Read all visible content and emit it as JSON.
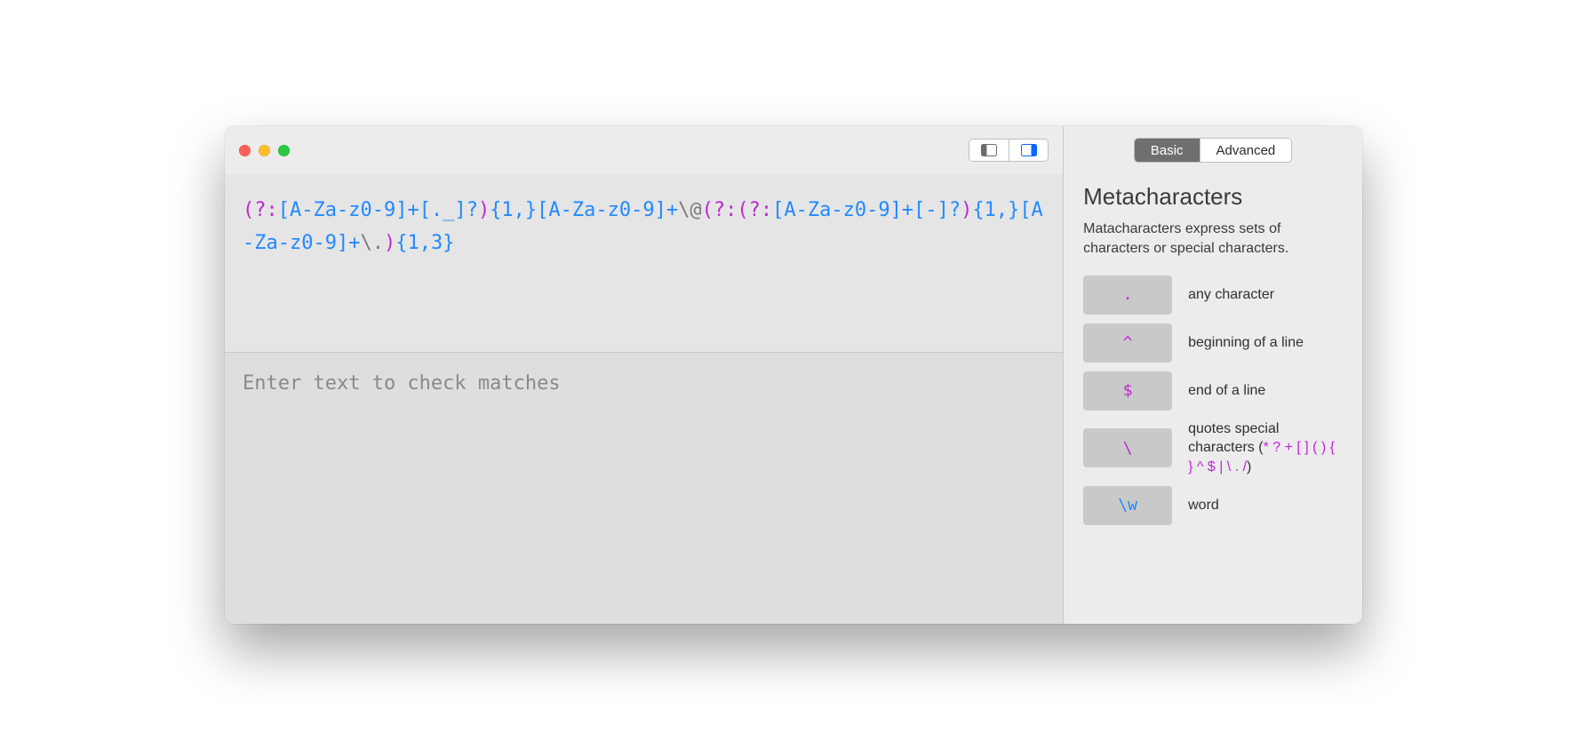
{
  "regex_tokens": [
    {
      "t": "(?:",
      "c": "magenta"
    },
    {
      "t": "[A-Za-z0-9]",
      "c": "blue"
    },
    {
      "t": "+",
      "c": "blue"
    },
    {
      "t": "[._]",
      "c": "blue"
    },
    {
      "t": "?",
      "c": "blue"
    },
    {
      "t": ")",
      "c": "magenta"
    },
    {
      "t": "{1,}",
      "c": "blue"
    },
    {
      "t": "[A-Za-z0-9]",
      "c": "blue"
    },
    {
      "t": "+",
      "c": "blue"
    },
    {
      "t": "\\",
      "c": "gray"
    },
    {
      "t": "@",
      "c": "gray"
    },
    {
      "t": "(?:",
      "c": "magenta"
    },
    {
      "t": "(?:",
      "c": "magenta"
    },
    {
      "t": "[A-Za-z0-9]",
      "c": "blue"
    },
    {
      "t": "+",
      "c": "blue"
    },
    {
      "t": "[-]",
      "c": "blue"
    },
    {
      "t": "?",
      "c": "blue"
    },
    {
      "t": ")",
      "c": "magenta"
    },
    {
      "t": "{1,}",
      "c": "blue"
    },
    {
      "t": "[A-Za-z0-9]",
      "c": "blue"
    },
    {
      "t": "+",
      "c": "blue"
    },
    {
      "t": "\\.",
      "c": "gray"
    },
    {
      "t": ")",
      "c": "magenta"
    },
    {
      "t": "{1,3}",
      "c": "blue"
    }
  ],
  "match_placeholder": "Enter text to check matches",
  "tabs": {
    "basic": "Basic",
    "advanced": "Advanced"
  },
  "sidebar": {
    "title": "Metacharacters",
    "desc": "Matacharacters express sets of characters or special characters.",
    "items": [
      {
        "symbol": ".",
        "color": "magenta",
        "label": "any character"
      },
      {
        "symbol": "^",
        "color": "magenta",
        "label": "beginning of a line"
      },
      {
        "symbol": "$",
        "color": "magenta",
        "label": "end of a line"
      },
      {
        "symbol": "\\",
        "color": "magenta",
        "label_prefix": "quotes special characters (",
        "label_highlight": "* ? + [ ] ( ) { } ^ $ | \\ . /",
        "label_suffix": ")"
      },
      {
        "symbol": "\\w",
        "color": "blue",
        "label": "word"
      }
    ]
  }
}
